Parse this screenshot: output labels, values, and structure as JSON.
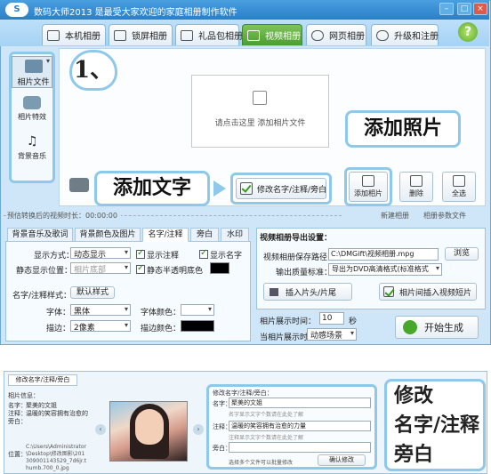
{
  "titlebar": {
    "logo": "S",
    "title": "数码大师2013   是最受大家欢迎的家庭相册制作软件"
  },
  "tabs": [
    {
      "label": "本机相册",
      "icon": "monitor-icon"
    },
    {
      "label": "锁屏相册",
      "icon": "tv-icon"
    },
    {
      "label": "礼品包相册",
      "icon": "gift-icon"
    },
    {
      "label": "视频相册",
      "icon": "film-icon"
    },
    {
      "label": "网页相册",
      "icon": "globe-icon"
    },
    {
      "label": "升级和注册",
      "icon": "upgrade-icon"
    }
  ],
  "help": "?",
  "sidebar": {
    "items": [
      {
        "label": "相片文件"
      },
      {
        "label": "相片特效"
      },
      {
        "label": "背景音乐"
      }
    ]
  },
  "balloon_step": "1、",
  "droparea": {
    "text": "请点击这里  添加相片文件"
  },
  "callouts": {
    "add_photo": "添加照片",
    "add_text": "添加文字",
    "edit_name": [
      "修改",
      "名字/注释",
      "旁白"
    ]
  },
  "toolbar": {
    "rename": "修改名字/注释/旁白",
    "add_photo": "添加相片",
    "delete": "删除",
    "select_all": "全选"
  },
  "status": {
    "total_time": "预估转换后的视频时长：00:00:00",
    "new_album": "新建相册",
    "album_params": "相册参数文件"
  },
  "subtabs": [
    "背景音乐及歌词",
    "背景颜色及图片",
    "名字/注释",
    "旁白",
    "水印"
  ],
  "left_panel": {
    "display_mode_label": "显示方式：",
    "display_mode": "动态显示",
    "show_note": "显示注释",
    "show_name": "显示名字",
    "static_pos_label": "静态显示位置：",
    "static_pos": "相片底部",
    "static_translucent": "静态半透明底色",
    "style_label": "名字/注释样式：",
    "style_btn": "默认样式",
    "font_label": "字体：",
    "font": "黑体",
    "font_color_label": "字体颜色：",
    "stroke_label": "描边：",
    "stroke": "2像素",
    "stroke_color_label": "描边颜色："
  },
  "right_panel": {
    "header": "视频相册导出设置：",
    "path_label": "视频相册保存路径：",
    "path": "C:\\DMGift\\视频相册.mpg",
    "browse": "浏览",
    "quality_label": "输出质量标准：",
    "quality": "导出为DVD高清格式(标准格式",
    "insert_head": "插入片头/片尾",
    "insert_clip": "相片间插入视频短片",
    "time_label": "相片展示时间：",
    "time_value": "10",
    "time_unit": "秒",
    "scene_label": "当相片展示时：",
    "scene": "动感场景",
    "generate": "开始生成"
  },
  "dialog": {
    "tab": "修改名字/注释/旁白",
    "info_header": "相片信息：",
    "name_label": "名字：",
    "name_value": "聚美的文姐",
    "note_label": "注释：",
    "note_value": "温暖的笑容拥有治愈的",
    "voice_label": "旁白：",
    "path_label": "位置：",
    "path_value": "C:\\Users\\Administrator\\Desktop\\修改图影\\201309001143529_7d6jr.thumb.700_0.jpg",
    "edit_header": "修改名字/注释/旁白：",
    "edit_name_label": "名字：",
    "edit_name_value": "聚美的文姐",
    "edit_name_hint": "聚美的文姐",
    "edit_name_sub": "名字显示文字个数请在此处了解",
    "edit_note_label": "注释：",
    "edit_note_value": "温暖的笑容拥有治愈的力量",
    "edit_note_sub": "注释显示文字个数请在此处了解",
    "edit_voice_label": "旁白：",
    "batch_text": "选择多个文件可以批量修改",
    "confirm": "确认修改"
  }
}
